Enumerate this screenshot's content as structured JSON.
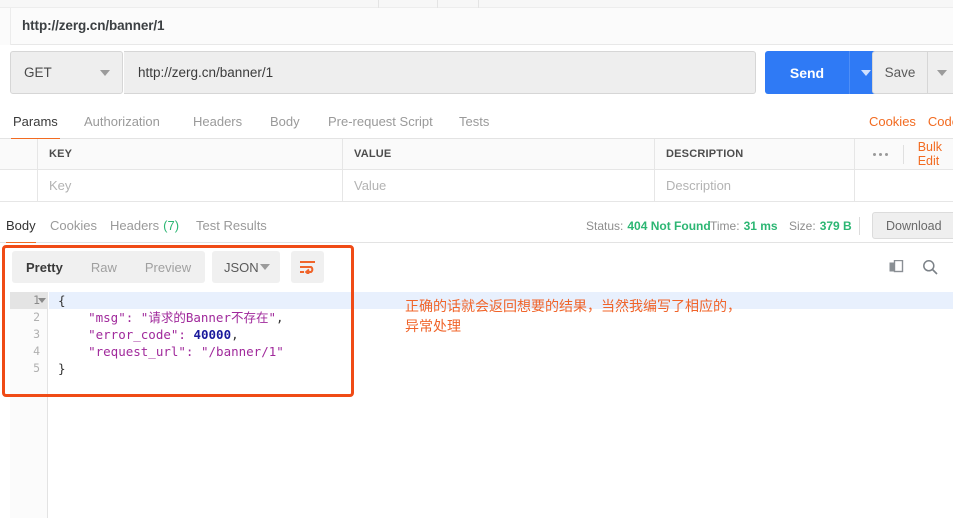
{
  "window": {
    "request_tab_title": "http://zerg.cn/banner/1"
  },
  "url_bar": {
    "method": "GET",
    "url": "http://zerg.cn/banner/1",
    "send_label": "Send",
    "save_label": "Save"
  },
  "request_tabs": {
    "items": [
      {
        "label": "Params",
        "active": true
      },
      {
        "label": "Authorization",
        "active": false
      },
      {
        "label": "Headers",
        "active": false
      },
      {
        "label": "Body",
        "active": false
      },
      {
        "label": "Pre-request Script",
        "active": false
      },
      {
        "label": "Tests",
        "active": false
      }
    ],
    "links": [
      {
        "label": "Cookies"
      },
      {
        "label": "Code"
      }
    ]
  },
  "params_table": {
    "headers": [
      "KEY",
      "VALUE",
      "DESCRIPTION"
    ],
    "bulk_edit_label": "Bulk Edit",
    "rows": [
      {
        "key": "Key",
        "value": "Value",
        "description": "Description"
      }
    ]
  },
  "response": {
    "tabs": [
      {
        "label": "Body",
        "active": true,
        "count": ""
      },
      {
        "label": "Cookies",
        "active": false,
        "count": ""
      },
      {
        "label": "Headers",
        "active": false,
        "count": "(7)"
      },
      {
        "label": "Test Results",
        "active": false,
        "count": ""
      }
    ],
    "status_key": "Status:",
    "status_value": "404 Not Found",
    "time_key": "Time:",
    "time_value": "31 ms",
    "size_key": "Size:",
    "size_value": "379 B",
    "download_label": "Download"
  },
  "body_viewer": {
    "formats": [
      {
        "label": "Pretty",
        "active": true
      },
      {
        "label": "Raw",
        "active": false
      },
      {
        "label": "Preview",
        "active": false
      }
    ],
    "language": "JSON",
    "wrap_icon": "wrap-lines-icon",
    "copy_icon": "copy-icon",
    "search_icon": "search-icon"
  },
  "code": {
    "line_numbers": [
      "1",
      "2",
      "3",
      "4",
      "5"
    ],
    "lines": [
      {
        "n": 1,
        "tokens": [
          {
            "t": "{",
            "c": "tok-brace"
          }
        ]
      },
      {
        "n": 2,
        "tokens": [
          {
            "t": "    \"msg\": ",
            "c": "tok-key"
          },
          {
            "t": "\"请求的Banner不存在\"",
            "c": "tok-str"
          },
          {
            "t": ",",
            "c": "tok-p"
          }
        ]
      },
      {
        "n": 3,
        "tokens": [
          {
            "t": "    \"error_code\": ",
            "c": "tok-key"
          },
          {
            "t": "40000",
            "c": "tok-num"
          },
          {
            "t": ",",
            "c": "tok-p"
          }
        ]
      },
      {
        "n": 4,
        "tokens": [
          {
            "t": "    \"request_url\": ",
            "c": "tok-key"
          },
          {
            "t": "\"/banner/1\"",
            "c": "tok-str"
          }
        ]
      },
      {
        "n": 5,
        "tokens": [
          {
            "t": "}",
            "c": "tok-brace"
          }
        ]
      }
    ],
    "raw_json": {
      "msg": "请求的Banner不存在",
      "error_code": 40000,
      "request_url": "/banner/1"
    }
  },
  "annotation": {
    "line1": "正确的话就会返回想要的结果，当然我编写了相应的，",
    "line2": "异常处理",
    "color": "#f0642a"
  },
  "colors": {
    "accent_orange": "#f26b21",
    "send_blue": "#2f7af5",
    "status_green": "#2cb673",
    "highlight_red": "#f04b16",
    "json_key_purple": "#a0299b",
    "json_number_blue": "#1a1a9c"
  }
}
